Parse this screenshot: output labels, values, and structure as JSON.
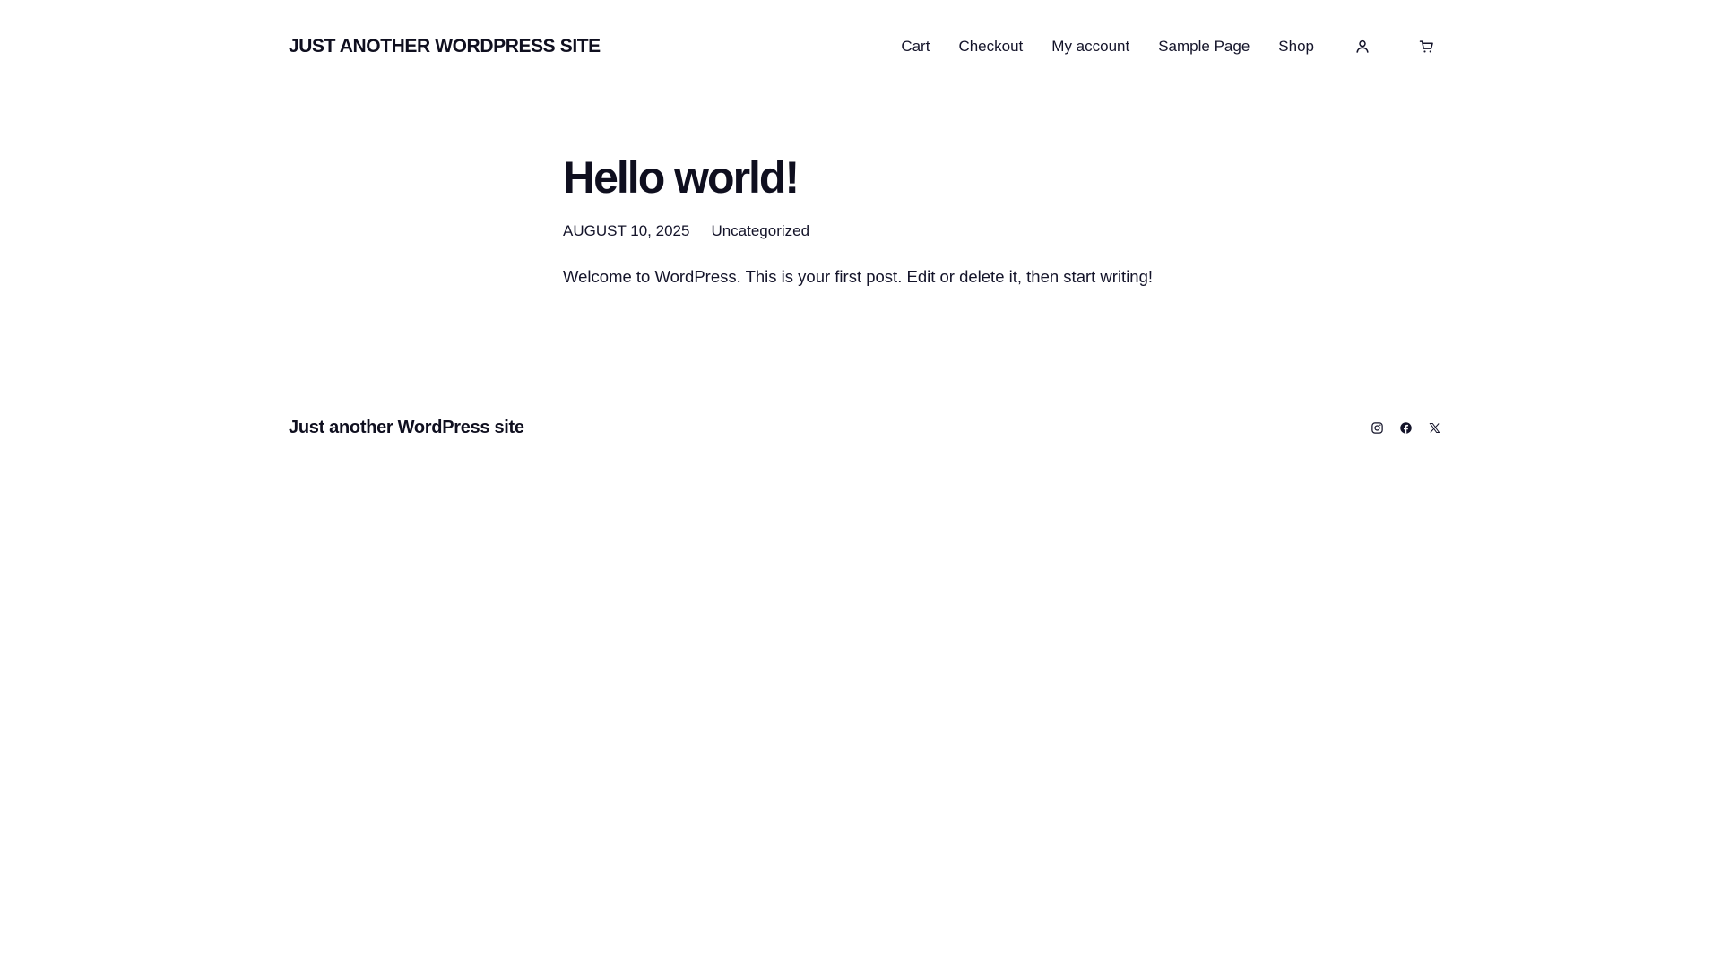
{
  "header": {
    "site_title": "JUST ANOTHER WORDPRESS SITE",
    "nav": [
      {
        "label": "Cart"
      },
      {
        "label": "Checkout"
      },
      {
        "label": "My account"
      },
      {
        "label": "Sample Page"
      },
      {
        "label": "Shop"
      }
    ],
    "icons": [
      "user-icon",
      "cart-icon"
    ]
  },
  "post": {
    "title": "Hello world!",
    "date": "AUGUST 10, 2025",
    "category": "Uncategorized",
    "content": "Welcome to WordPress. This is your first post. Edit or delete it, then start writing!"
  },
  "footer": {
    "site_title": "Just another WordPress site",
    "social_icons": [
      "instagram-icon",
      "facebook-icon",
      "x-icon"
    ]
  },
  "colors": {
    "text": "#14142a",
    "heading": "#0f0f1f",
    "background": "#ffffff"
  }
}
